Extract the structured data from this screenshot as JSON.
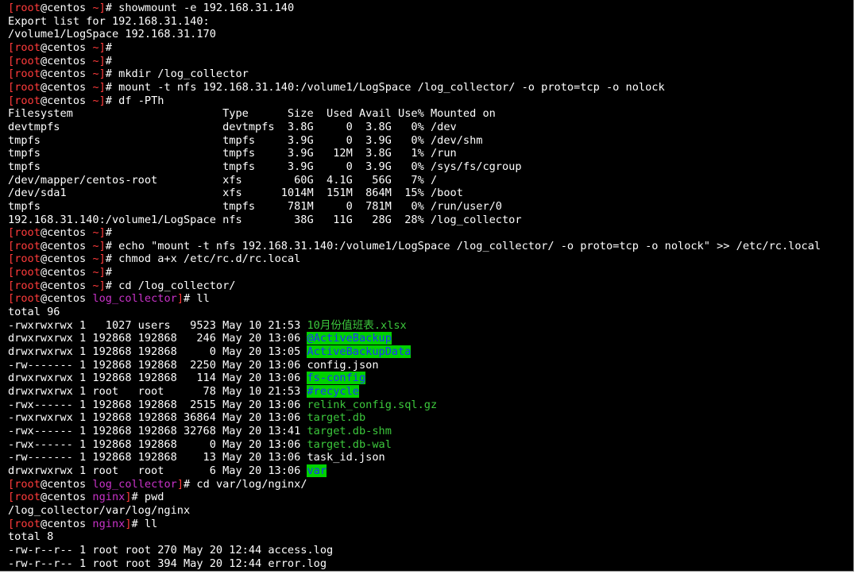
{
  "terminal": {
    "colors": {
      "background": "#000000",
      "text": "#ffffff",
      "prompt_bracket": "#ff3b3b",
      "directory": "#c832c8",
      "file_executable": "#3cc83c",
      "dir_highlight_bg": "#00d200",
      "dir_highlight_fg": "#1e32ff"
    },
    "lines": [
      {
        "type": "prompt",
        "user": "root",
        "host": "centos",
        "dir": "~",
        "cmd": "showmount -e 192.168.31.140"
      },
      {
        "type": "text",
        "text": "Export list for 192.168.31.140:"
      },
      {
        "type": "text",
        "text": "/volume1/LogSpace 192.168.31.170"
      },
      {
        "type": "prompt",
        "user": "root",
        "host": "centos",
        "dir": "~",
        "cmd": ""
      },
      {
        "type": "prompt",
        "user": "root",
        "host": "centos",
        "dir": "~",
        "cmd": ""
      },
      {
        "type": "prompt",
        "user": "root",
        "host": "centos",
        "dir": "~",
        "cmd": "mkdir /log_collector"
      },
      {
        "type": "prompt",
        "user": "root",
        "host": "centos",
        "dir": "~",
        "cmd": "mount -t nfs 192.168.31.140:/volume1/LogSpace /log_collector/ -o proto=tcp -o nolock"
      },
      {
        "type": "prompt",
        "user": "root",
        "host": "centos",
        "dir": "~",
        "cmd": "df -PTh"
      },
      {
        "type": "text",
        "text": "Filesystem                       Type      Size  Used Avail Use% Mounted on"
      },
      {
        "type": "text",
        "text": "devtmpfs                         devtmpfs  3.8G     0  3.8G   0% /dev"
      },
      {
        "type": "text",
        "text": "tmpfs                            tmpfs     3.9G     0  3.9G   0% /dev/shm"
      },
      {
        "type": "text",
        "text": "tmpfs                            tmpfs     3.9G   12M  3.8G   1% /run"
      },
      {
        "type": "text",
        "text": "tmpfs                            tmpfs     3.9G     0  3.9G   0% /sys/fs/cgroup"
      },
      {
        "type": "text",
        "text": "/dev/mapper/centos-root          xfs        60G  4.1G   56G   7% /"
      },
      {
        "type": "text",
        "text": "/dev/sda1                        xfs      1014M  151M  864M  15% /boot"
      },
      {
        "type": "text",
        "text": "tmpfs                            tmpfs     781M     0  781M   0% /run/user/0"
      },
      {
        "type": "text",
        "text": "192.168.31.140:/volume1/LogSpace nfs        38G   11G   28G  28% /log_collector"
      },
      {
        "type": "prompt",
        "user": "root",
        "host": "centos",
        "dir": "~",
        "cmd": ""
      },
      {
        "type": "prompt",
        "user": "root",
        "host": "centos",
        "dir": "~",
        "cmd": "echo \"mount -t nfs 192.168.31.140:/volume1/LogSpace /log_collector/ -o proto=tcp -o nolock\" >> /etc/rc.local"
      },
      {
        "type": "prompt",
        "user": "root",
        "host": "centos",
        "dir": "~",
        "cmd": "chmod a+x /etc/rc.d/rc.local"
      },
      {
        "type": "prompt",
        "user": "root",
        "host": "centos",
        "dir": "~",
        "cmd": ""
      },
      {
        "type": "prompt",
        "user": "root",
        "host": "centos",
        "dir": "~",
        "cmd": "cd /log_collector/"
      },
      {
        "type": "prompt",
        "user": "root",
        "host": "centos",
        "dir": "log_collector",
        "dir_color": "magenta",
        "cmd": "ll"
      },
      {
        "type": "text",
        "text": "total 96"
      },
      {
        "type": "ls",
        "prefix": "-rwxrwxrwx 1   1027 users   9523 May 10 21:53 ",
        "name": "10月份值班表.xlsx",
        "style": "green"
      },
      {
        "type": "ls",
        "prefix": "drwxrwxrwx 1 192868 192868   246 May 20 13:06 ",
        "name": "@ActiveBackup",
        "style": "hl"
      },
      {
        "type": "ls",
        "prefix": "drwxrwxrwx 1 192868 192868     0 May 20 13:05 ",
        "name": "ActiveBackupData",
        "style": "hl"
      },
      {
        "type": "ls",
        "prefix": "-rw------- 1 192868 192868  2250 May 20 13:06 ",
        "name": "config.json",
        "style": "plain"
      },
      {
        "type": "ls",
        "prefix": "drwxrwxrwx 1 192868 192868   114 May 20 13:06 ",
        "name": "fs-config",
        "style": "hl"
      },
      {
        "type": "ls",
        "prefix": "drwxrwxrwx 1 root   root      78 May 10 21:53 ",
        "name": "#recycle",
        "style": "hl"
      },
      {
        "type": "ls",
        "prefix": "-rwx------ 1 192868 192868  2515 May 20 13:06 ",
        "name": "relink_config.sql.gz",
        "style": "green"
      },
      {
        "type": "ls",
        "prefix": "-rwxrwxrwx 1 192868 192868 36864 May 20 13:06 ",
        "name": "target.db",
        "style": "green"
      },
      {
        "type": "ls",
        "prefix": "-rwx------ 1 192868 192868 32768 May 20 13:41 ",
        "name": "target.db-shm",
        "style": "green"
      },
      {
        "type": "ls",
        "prefix": "-rwx------ 1 192868 192868     0 May 20 13:06 ",
        "name": "target.db-wal",
        "style": "green"
      },
      {
        "type": "ls",
        "prefix": "-rw------- 1 192868 192868    13 May 20 13:06 ",
        "name": "task_id.json",
        "style": "plain"
      },
      {
        "type": "ls",
        "prefix": "drwxrwxrwx 1 root   root       6 May 20 13:06 ",
        "name": "var",
        "style": "hl"
      },
      {
        "type": "prompt",
        "user": "root",
        "host": "centos",
        "dir": "log_collector",
        "dir_color": "magenta",
        "cmd": "cd var/log/nginx/"
      },
      {
        "type": "prompt",
        "user": "root",
        "host": "centos",
        "dir": "nginx",
        "dir_color": "magenta",
        "cmd": "pwd"
      },
      {
        "type": "text",
        "text": "/log_collector/var/log/nginx"
      },
      {
        "type": "prompt",
        "user": "root",
        "host": "centos",
        "dir": "nginx",
        "dir_color": "magenta",
        "cmd": "ll"
      },
      {
        "type": "text",
        "text": "total 8"
      },
      {
        "type": "text",
        "text": "-rw-r--r-- 1 root root 270 May 20 12:44 access.log"
      },
      {
        "type": "text",
        "text": "-rw-r--r-- 1 root root 394 May 20 12:44 error.log"
      }
    ]
  }
}
